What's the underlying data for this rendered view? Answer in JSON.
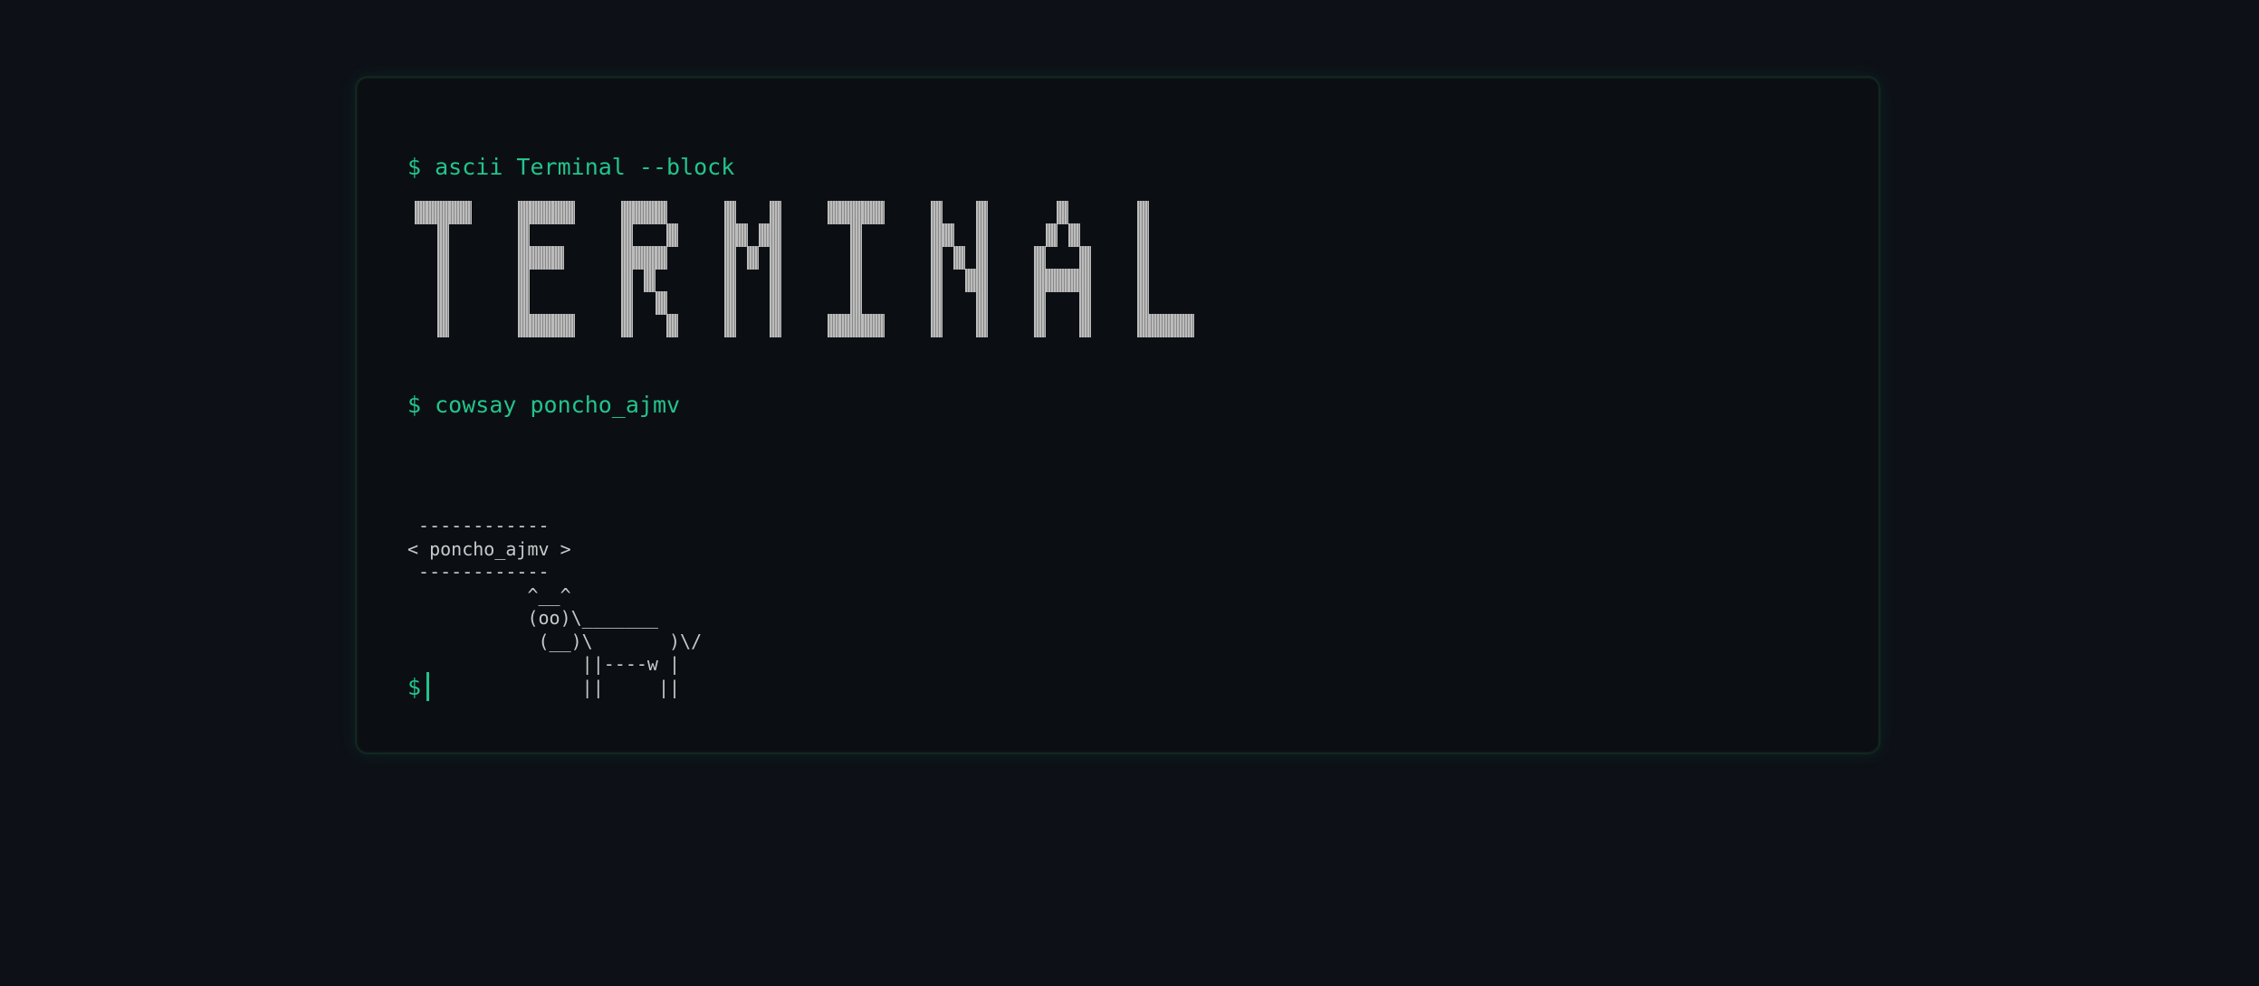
{
  "terminal": {
    "lines": [
      {
        "prompt": "$",
        "command": "ascii Terminal --block"
      },
      {
        "prompt": "$",
        "command": "cowsay poncho_ajmv"
      }
    ],
    "banner_text": "TERMINAL",
    "cowsay_output": " ------------\n< poncho_ajmv >\n ------------\n           ^__^\n           (oo)\\_______\n            (__)\\       )\\/\n                ||----w |\n                ||     ||",
    "current_prompt": "$",
    "current_input": ""
  },
  "colors": {
    "background": "#0d1117",
    "window": "#0b0f13",
    "accent": "#23c48b",
    "text": "#c9c9c9",
    "block": "#bcbcbc"
  }
}
